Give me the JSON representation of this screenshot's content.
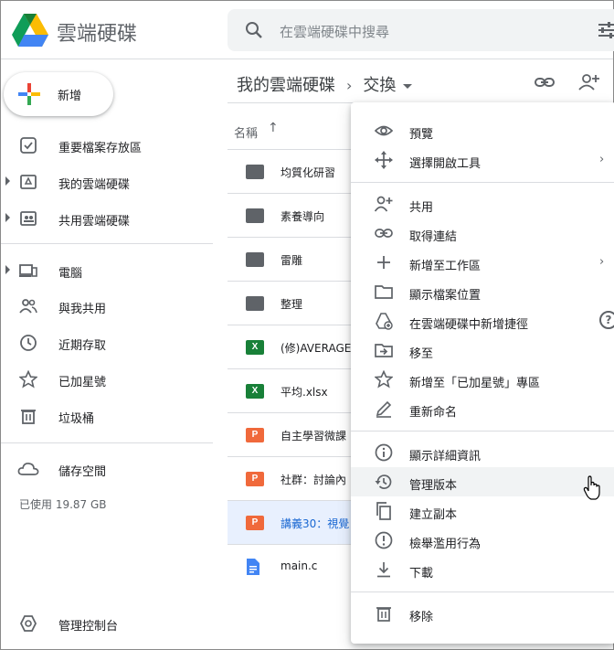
{
  "app": {
    "title": "雲端硬碟"
  },
  "search": {
    "placeholder": "在雲端硬碟中搜尋"
  },
  "sidebar": {
    "new_label": "新增",
    "items": [
      {
        "label": "重要檔案存放區",
        "icon": "priority-icon"
      },
      {
        "label": "我的雲端硬碟",
        "icon": "my-drive-icon"
      },
      {
        "label": "共用雲端硬碟",
        "icon": "shared-drives-icon"
      },
      {
        "label": "電腦",
        "icon": "computers-icon"
      },
      {
        "label": "與我共用",
        "icon": "shared-with-me-icon"
      },
      {
        "label": "近期存取",
        "icon": "recent-icon"
      },
      {
        "label": "已加星號",
        "icon": "star-icon"
      },
      {
        "label": "垃圾桶",
        "icon": "trash-icon"
      },
      {
        "label": "儲存空間",
        "icon": "cloud-icon"
      },
      {
        "label": "管理控制台",
        "icon": "admin-console-icon"
      }
    ],
    "storage_used": "已使用 19.87 GB"
  },
  "breadcrumb": {
    "root": "我的雲端硬碟",
    "current": "交換"
  },
  "file_list": {
    "column_name": "名稱",
    "sort_arrow": "↑",
    "files": [
      {
        "name": "均質化研習",
        "type": "folder"
      },
      {
        "name": "素養導向",
        "type": "folder"
      },
      {
        "name": "雷雕",
        "type": "folder"
      },
      {
        "name": "整理",
        "type": "folder"
      },
      {
        "name": "(修)AVERAGE",
        "type": "sheet",
        "badge": "X"
      },
      {
        "name": "平均.xlsx",
        "type": "sheet",
        "badge": "X"
      },
      {
        "name": "自主學習微課",
        "type": "slides",
        "badge": "P"
      },
      {
        "name": "社群：討論內",
        "type": "slides",
        "badge": "P"
      },
      {
        "name": "講義30：視覺",
        "type": "slides",
        "badge": "P"
      },
      {
        "name": "main.c",
        "type": "doc"
      }
    ]
  },
  "context_menu": {
    "items": [
      {
        "label": "預覽",
        "icon": "eye-icon"
      },
      {
        "label": "選擇開啟工具",
        "icon": "move-arrows-icon",
        "arrow": "›"
      },
      {
        "label": "共用",
        "icon": "person-add-icon"
      },
      {
        "label": "取得連結",
        "icon": "link-icon"
      },
      {
        "label": "新增至工作區",
        "icon": "plus-icon",
        "arrow": "›"
      },
      {
        "label": "顯示檔案位置",
        "icon": "folder-outline-icon"
      },
      {
        "label": "在雲端硬碟中新增捷徑",
        "icon": "drive-shortcut-icon",
        "help": "?"
      },
      {
        "label": "移至",
        "icon": "move-to-icon"
      },
      {
        "label": "新增至「已加星號」專區",
        "icon": "star-outline-icon"
      },
      {
        "label": "重新命名",
        "icon": "pencil-icon"
      },
      {
        "label": "顯示詳細資訊",
        "icon": "info-icon"
      },
      {
        "label": "管理版本",
        "icon": "history-icon"
      },
      {
        "label": "建立副本",
        "icon": "copy-icon"
      },
      {
        "label": "檢舉濫用行為",
        "icon": "report-icon"
      },
      {
        "label": "下載",
        "icon": "download-icon"
      },
      {
        "label": "移除",
        "icon": "trash-outline-icon"
      }
    ]
  },
  "colors": {
    "accent": "#1967d2",
    "selected_bg": "#e8f0fe",
    "sheet": "#188038",
    "slides": "#f0693b",
    "doc": "#4285f4"
  }
}
